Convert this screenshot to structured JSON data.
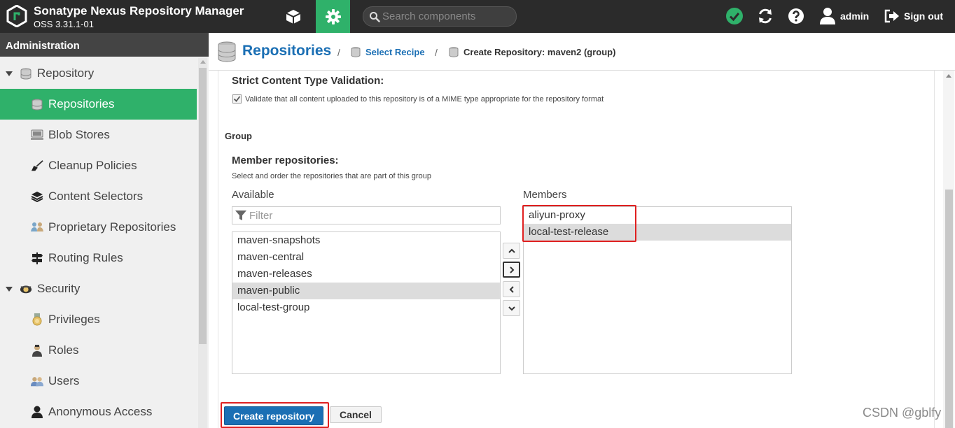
{
  "app": {
    "title": "Sonatype Nexus Repository Manager",
    "version": "OSS 3.31.1-01"
  },
  "topbar": {
    "search_placeholder": "Search components",
    "user_label": "admin",
    "signout_label": "Sign out",
    "status_color": "#2fb16a"
  },
  "sidebar": {
    "header": "Administration",
    "items": [
      {
        "label": "Repository",
        "type": "group",
        "icon": "database-icon"
      },
      {
        "label": "Repositories",
        "type": "child",
        "icon": "database-icon",
        "selected": true
      },
      {
        "label": "Blob Stores",
        "type": "child",
        "icon": "server-icon"
      },
      {
        "label": "Cleanup Policies",
        "type": "child",
        "icon": "broom-icon"
      },
      {
        "label": "Content Selectors",
        "type": "child",
        "icon": "layers-icon"
      },
      {
        "label": "Proprietary Repositories",
        "type": "child",
        "icon": "people-icon"
      },
      {
        "label": "Routing Rules",
        "type": "child",
        "icon": "signpost-icon"
      },
      {
        "label": "Security",
        "type": "group",
        "icon": "police-icon"
      },
      {
        "label": "Privileges",
        "type": "child",
        "icon": "medal-icon"
      },
      {
        "label": "Roles",
        "type": "child",
        "icon": "role-icon"
      },
      {
        "label": "Users",
        "type": "child",
        "icon": "users-icon"
      },
      {
        "label": "Anonymous Access",
        "type": "child",
        "icon": "user-icon"
      }
    ]
  },
  "breadcrumb": {
    "title": "Repositories",
    "sep": "/",
    "step1": "Select Recipe",
    "step2": "Create Repository: maven2 (group)"
  },
  "form": {
    "strict_title": "Strict Content Type Validation:",
    "strict_desc": "Validate that all content uploaded to this repository is of a MIME type appropriate for the repository format",
    "strict_checked": true,
    "group_section": "Group",
    "member_title": "Member repositories:",
    "member_desc": "Select and order the repositories that are part of this group",
    "available_label": "Available",
    "members_label": "Members",
    "filter_placeholder": "Filter",
    "available": [
      "maven-snapshots",
      "maven-central",
      "maven-releases",
      "maven-public",
      "local-test-group"
    ],
    "available_selected": "maven-public",
    "members": [
      "aliyun-proxy",
      "local-test-release"
    ],
    "members_selected": "local-test-release",
    "create_label": "Create repository",
    "cancel_label": "Cancel"
  },
  "watermark": "CSDN @gblfy",
  "colors": {
    "accent": "#2fb16a",
    "link": "#1b6fb4",
    "highlight": "#e02020",
    "topbar": "#2b2b2b"
  }
}
